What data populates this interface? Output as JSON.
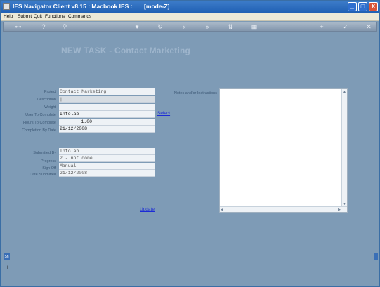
{
  "window": {
    "title": "IES Navigator Client v8.15 : Macbook IES :       [mode-Z]",
    "controls": [
      "_",
      "□",
      "X"
    ]
  },
  "menu": {
    "items": [
      "Help",
      "Submit",
      "Quit",
      "Functions",
      "Commands"
    ]
  },
  "toolbar": {
    "icons": [
      "key-icon",
      "help-icon",
      "search-icon",
      "heart-icon",
      "refresh-icon",
      "rewind-icon",
      "fast-forward-icon",
      "up-down-icon",
      "grid-icon",
      "add-icon",
      "check-icon",
      "close-icon"
    ],
    "glyphs": [
      "⊶",
      "?",
      "⚲",
      "♥",
      "↻",
      "«",
      "»",
      "⇅",
      "▦",
      "+",
      "✓",
      "✕"
    ]
  },
  "page": {
    "heading": "NEW TASK - Contact Marketing"
  },
  "form": {
    "project_label": "Project",
    "project_value": "Contact Marketing",
    "description_label": "Description",
    "description_value": "|",
    "weight_label": "Weight",
    "weight_value": "",
    "user_label": "User To Complete",
    "user_value": "Infolab",
    "select_link": "Select",
    "hours_label": "Hours To Complete",
    "hours_value": "1.00",
    "date_label": "Completion By Date",
    "date_value": "21/12/2008",
    "submitted_by_label": "Submitted By",
    "submitted_by_value": "Infolab",
    "progress_label": "Progress",
    "progress_value": "2 - not done",
    "signoff_label": "Sign Off",
    "signoff_value": "Manual",
    "date_submitted_label": "Date Submitted",
    "date_submitted_value": "21/12/2008",
    "update_link": "Update"
  },
  "notes": {
    "label": "Notes and/or Instructions",
    "value": ""
  },
  "side": {
    "tab_label": "Sh",
    "icon_label": "i"
  }
}
